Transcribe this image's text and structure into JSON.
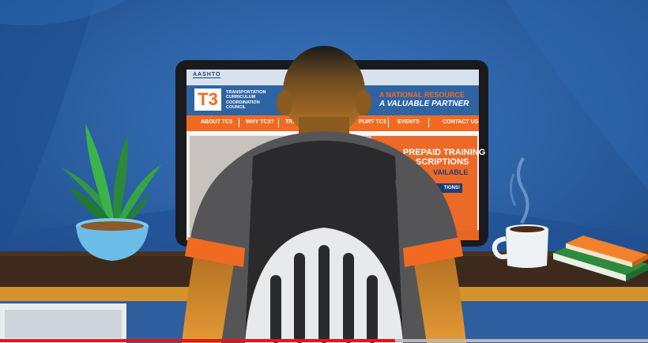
{
  "scene": {
    "colors": {
      "wall": "#2c5fa8",
      "desk": "#3d2a1c",
      "brand_orange": "#f26a21",
      "site_blue": "#2f64a3"
    }
  },
  "website": {
    "header_logo": "AASHTO",
    "brand_mark": "T3",
    "org_name_lines": [
      "TRANSPORTATION",
      "CURRICULUM",
      "COORDINATION",
      "COUNCIL"
    ],
    "tagline_line1": "A NATIONAL RESOURCE",
    "tagline_line2": "A VALUABLE PARTNER",
    "nav": [
      "ABOUT TC3",
      "WHY TC3?",
      "TRA",
      "PORT TC3",
      "EVENTS",
      "CONTACT US"
    ],
    "banner_line1": "PREPAID TRAINING",
    "banner_line2": "SCRIPTIONS",
    "banner_line3": "VAILABLE",
    "banner_button": "TIONS!"
  },
  "video": {
    "progress_fraction": 0.61
  }
}
